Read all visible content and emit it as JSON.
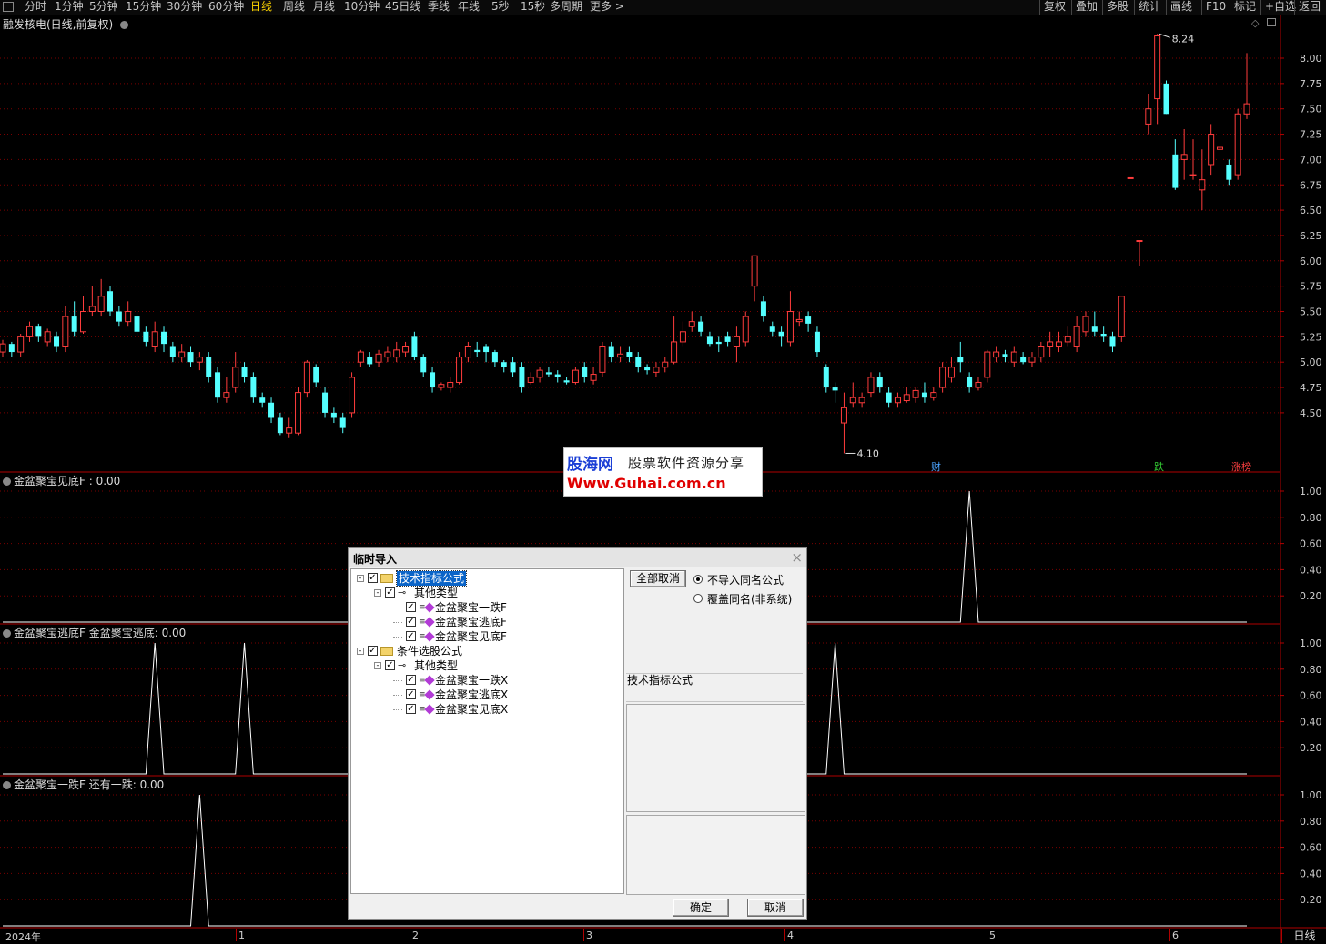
{
  "toolbar": {
    "periods": [
      "分时",
      "1分钟",
      "5分钟",
      "15分钟",
      "30分钟",
      "60分钟",
      "日线",
      "周线",
      "月线",
      "10分钟",
      "45日线",
      "季线",
      "年线",
      "5秒",
      "15秒",
      "多周期",
      "更多 >"
    ],
    "active_period": "日线",
    "right_buttons": [
      "复权",
      "叠加",
      "多股",
      "统计",
      "画线",
      "F10",
      "标记",
      "+自选",
      "返回"
    ]
  },
  "main_pane": {
    "title": "融发核电(日线,前复权)",
    "high_label": "8.24",
    "low_label": "4.10",
    "y_ticks": [
      "8.00",
      "7.75",
      "7.50",
      "7.25",
      "7.00",
      "6.75",
      "6.50",
      "6.25",
      "6.00",
      "5.75",
      "5.50",
      "5.25",
      "5.00",
      "4.75",
      "4.50"
    ],
    "markers": [
      {
        "text": "财",
        "color": "#4aa3ff"
      },
      {
        "text": "跌",
        "color": "#33cc33"
      },
      {
        "text": "涨榜",
        "color": "#ff4040"
      }
    ]
  },
  "indicator_panes": [
    {
      "title": "金盆聚宝见底F : 0.00",
      "y_ticks": [
        "1.00",
        "0.80",
        "0.60",
        "0.40",
        "0.20"
      ]
    },
    {
      "title": "金盆聚宝逃底F  金盆聚宝逃底: 0.00",
      "y_ticks": [
        "1.00",
        "0.80",
        "0.60",
        "0.40",
        "0.20"
      ]
    },
    {
      "title": "金盆聚宝一跌F  还有一跌: 0.00",
      "y_ticks": [
        "1.00",
        "0.80",
        "0.60",
        "0.40",
        "0.20"
      ]
    }
  ],
  "x_axis": {
    "labels": [
      "2024年",
      "1",
      "2",
      "3",
      "4",
      "5",
      "6"
    ],
    "period_label": "日线"
  },
  "watermark": {
    "logo": "股海网",
    "slogan": "股票软件资源分享",
    "url": "Www.Guhai.com.cn"
  },
  "dialog": {
    "title": "临时导入",
    "close": "×",
    "tree": [
      {
        "label": "技术指标公式",
        "level": 0,
        "kind": "folder",
        "selected": true
      },
      {
        "label": "其他类型",
        "level": 1,
        "kind": "key"
      },
      {
        "label": "金盆聚宝一跌F",
        "level": 2,
        "kind": "gem"
      },
      {
        "label": "金盆聚宝逃底F",
        "level": 2,
        "kind": "gem"
      },
      {
        "label": "金盆聚宝见底F",
        "level": 2,
        "kind": "gem"
      },
      {
        "label": "条件选股公式",
        "level": 0,
        "kind": "folder"
      },
      {
        "label": "其他类型",
        "level": 1,
        "kind": "key"
      },
      {
        "label": "金盆聚宝一跌X",
        "level": 2,
        "kind": "gem"
      },
      {
        "label": "金盆聚宝逃底X",
        "level": 2,
        "kind": "gem"
      },
      {
        "label": "金盆聚宝见底X",
        "level": 2,
        "kind": "gem"
      }
    ],
    "cancel_all_label": "全部取消",
    "radio_no_import": "不导入同名公式",
    "radio_overwrite": "覆盖同名(非系统)",
    "info_label": "技术指标公式",
    "ok_label": "确定",
    "cancel_label": "取消"
  },
  "colors": {
    "up": "#ff3c3c",
    "down": "#54ffff",
    "grid": "#7a0000",
    "axis": "#b00000",
    "active_tab": "#ffd700"
  },
  "chart_data": {
    "type": "candlestick",
    "title": "融发核电(日线,前复权)",
    "ylim": [
      4.0,
      8.3
    ],
    "note_extremes": {
      "high": 8.24,
      "low": 4.1
    },
    "x_labels": [
      "2024年",
      "1",
      "2",
      "3",
      "4",
      "5",
      "6"
    ],
    "candles": [
      [
        5.1,
        5.18,
        5.22,
        5.05
      ],
      [
        5.18,
        5.1,
        5.2,
        5.05
      ],
      [
        5.1,
        5.25,
        5.28,
        5.05
      ],
      [
        5.25,
        5.35,
        5.4,
        5.2
      ],
      [
        5.35,
        5.25,
        5.38,
        5.2
      ],
      [
        5.2,
        5.3,
        5.33,
        5.15
      ],
      [
        5.25,
        5.15,
        5.3,
        5.1
      ],
      [
        5.15,
        5.45,
        5.55,
        5.1
      ],
      [
        5.45,
        5.3,
        5.6,
        5.25
      ],
      [
        5.3,
        5.5,
        5.65,
        5.28
      ],
      [
        5.5,
        5.55,
        5.75,
        5.45
      ],
      [
        5.5,
        5.65,
        5.82,
        5.45
      ],
      [
        5.7,
        5.5,
        5.75,
        5.45
      ],
      [
        5.5,
        5.4,
        5.55,
        5.35
      ],
      [
        5.4,
        5.5,
        5.6,
        5.35
      ],
      [
        5.45,
        5.3,
        5.5,
        5.25
      ],
      [
        5.3,
        5.2,
        5.35,
        5.15
      ],
      [
        5.15,
        5.3,
        5.4,
        5.1
      ],
      [
        5.3,
        5.18,
        5.35,
        5.1
      ],
      [
        5.15,
        5.05,
        5.2,
        5.0
      ],
      [
        5.05,
        5.1,
        5.18,
        5.0
      ],
      [
        5.1,
        5.0,
        5.15,
        4.95
      ],
      [
        5.0,
        5.05,
        5.1,
        4.92
      ],
      [
        5.05,
        4.85,
        5.1,
        4.8
      ],
      [
        4.9,
        4.65,
        4.95,
        4.6
      ],
      [
        4.65,
        4.7,
        4.85,
        4.6
      ],
      [
        4.75,
        4.95,
        5.1,
        4.7
      ],
      [
        4.95,
        4.85,
        5.0,
        4.8
      ],
      [
        4.85,
        4.65,
        4.9,
        4.6
      ],
      [
        4.65,
        4.6,
        4.7,
        4.55
      ],
      [
        4.6,
        4.45,
        4.65,
        4.4
      ],
      [
        4.45,
        4.3,
        4.5,
        4.28
      ],
      [
        4.3,
        4.35,
        4.45,
        4.25
      ],
      [
        4.3,
        4.7,
        4.75,
        4.28
      ],
      [
        4.7,
        5.0,
        5.02,
        4.65
      ],
      [
        4.95,
        4.8,
        4.98,
        4.75
      ],
      [
        4.7,
        4.5,
        4.75,
        4.45
      ],
      [
        4.5,
        4.45,
        4.55,
        4.4
      ],
      [
        4.45,
        4.35,
        4.5,
        4.3
      ],
      [
        4.5,
        4.85,
        4.9,
        4.45
      ],
      [
        5.0,
        5.1,
        5.12,
        4.95
      ],
      [
        5.05,
        4.98,
        5.1,
        4.95
      ],
      [
        5.0,
        5.08,
        5.12,
        4.95
      ],
      [
        5.05,
        5.1,
        5.15,
        5.0
      ],
      [
        5.05,
        5.12,
        5.2,
        5.0
      ],
      [
        5.1,
        5.15,
        5.2,
        5.05
      ],
      [
        5.25,
        5.05,
        5.3,
        5.02
      ],
      [
        5.05,
        4.9,
        5.08,
        4.85
      ],
      [
        4.9,
        4.75,
        4.95,
        4.7
      ],
      [
        4.75,
        4.78,
        4.8,
        4.72
      ],
      [
        4.75,
        4.8,
        4.85,
        4.7
      ],
      [
        4.8,
        5.05,
        5.1,
        4.78
      ],
      [
        5.05,
        5.15,
        5.2,
        5.0
      ],
      [
        5.12,
        5.1,
        5.2,
        5.05
      ],
      [
        5.15,
        5.1,
        5.18,
        5.0
      ],
      [
        5.1,
        5.0,
        5.12,
        4.95
      ],
      [
        5.0,
        4.95,
        5.02,
        4.9
      ],
      [
        5.0,
        4.9,
        5.05,
        4.85
      ],
      [
        4.95,
        4.75,
        5.0,
        4.7
      ],
      [
        4.8,
        4.85,
        4.9,
        4.78
      ],
      [
        4.85,
        4.92,
        4.95,
        4.8
      ],
      [
        4.9,
        4.88,
        4.95,
        4.85
      ],
      [
        4.88,
        4.85,
        4.92,
        4.8
      ],
      [
        4.82,
        4.8,
        4.85,
        4.78
      ],
      [
        4.8,
        4.92,
        4.95,
        4.78
      ],
      [
        4.95,
        4.85,
        5.0,
        4.8
      ],
      [
        4.82,
        4.88,
        4.95,
        4.78
      ],
      [
        4.9,
        5.15,
        5.2,
        4.85
      ],
      [
        5.15,
        5.05,
        5.2,
        5.0
      ],
      [
        5.05,
        5.08,
        5.15,
        5.0
      ],
      [
        5.1,
        5.05,
        5.15,
        5.0
      ],
      [
        5.05,
        4.95,
        5.1,
        4.9
      ],
      [
        4.95,
        4.92,
        4.98,
        4.88
      ],
      [
        4.9,
        4.95,
        5.0,
        4.85
      ],
      [
        4.95,
        5.0,
        5.05,
        4.9
      ],
      [
        5.0,
        5.2,
        5.45,
        4.98
      ],
      [
        5.2,
        5.3,
        5.4,
        5.15
      ],
      [
        5.35,
        5.4,
        5.5,
        5.3
      ],
      [
        5.4,
        5.3,
        5.45,
        5.25
      ],
      [
        5.25,
        5.18,
        5.3,
        5.15
      ],
      [
        5.2,
        5.18,
        5.25,
        5.1
      ],
      [
        5.25,
        5.2,
        5.3,
        5.15
      ],
      [
        5.15,
        5.25,
        5.35,
        5.0
      ],
      [
        5.2,
        5.45,
        5.5,
        5.15
      ],
      [
        5.75,
        6.05,
        6.05,
        5.6
      ],
      [
        5.6,
        5.45,
        5.65,
        5.4
      ],
      [
        5.35,
        5.3,
        5.4,
        5.25
      ],
      [
        5.3,
        5.25,
        5.35,
        5.15
      ],
      [
        5.2,
        5.5,
        5.7,
        5.15
      ],
      [
        5.4,
        5.42,
        5.5,
        5.35
      ],
      [
        5.45,
        5.38,
        5.5,
        5.3
      ],
      [
        5.3,
        5.1,
        5.35,
        5.05
      ],
      [
        4.95,
        4.75,
        4.98,
        4.7
      ],
      [
        4.75,
        4.72,
        4.8,
        4.6
      ],
      [
        4.4,
        4.55,
        4.7,
        4.1
      ],
      [
        4.6,
        4.65,
        4.8,
        4.55
      ],
      [
        4.6,
        4.65,
        4.7,
        4.55
      ],
      [
        4.7,
        4.85,
        4.9,
        4.65
      ],
      [
        4.85,
        4.75,
        4.9,
        4.7
      ],
      [
        4.7,
        4.6,
        4.75,
        4.55
      ],
      [
        4.6,
        4.65,
        4.7,
        4.55
      ],
      [
        4.62,
        4.68,
        4.75,
        4.6
      ],
      [
        4.65,
        4.72,
        4.75,
        4.6
      ],
      [
        4.7,
        4.65,
        4.8,
        4.6
      ],
      [
        4.65,
        4.7,
        4.75,
        4.62
      ],
      [
        4.75,
        4.95,
        5.0,
        4.7
      ],
      [
        4.85,
        4.95,
        5.05,
        4.8
      ],
      [
        5.05,
        5.0,
        5.2,
        4.9
      ],
      [
        4.85,
        4.75,
        4.9,
        4.7
      ],
      [
        4.75,
        4.8,
        4.85,
        4.72
      ],
      [
        4.85,
        5.1,
        5.12,
        4.8
      ],
      [
        5.05,
        5.1,
        5.15,
        5.0
      ],
      [
        5.08,
        5.05,
        5.12,
        5.0
      ],
      [
        5.0,
        5.1,
        5.15,
        4.95
      ],
      [
        5.05,
        5.0,
        5.1,
        4.98
      ],
      [
        5.0,
        5.05,
        5.1,
        4.95
      ],
      [
        5.05,
        5.15,
        5.2,
        5.0
      ],
      [
        5.15,
        5.2,
        5.3,
        5.05
      ],
      [
        5.15,
        5.2,
        5.3,
        5.1
      ],
      [
        5.2,
        5.25,
        5.35,
        5.15
      ],
      [
        5.15,
        5.35,
        5.45,
        5.1
      ],
      [
        5.3,
        5.45,
        5.5,
        5.25
      ],
      [
        5.35,
        5.3,
        5.5,
        5.25
      ],
      [
        5.28,
        5.25,
        5.35,
        5.2
      ],
      [
        5.25,
        5.15,
        5.3,
        5.1
      ],
      [
        5.25,
        5.65,
        5.65,
        5.2
      ],
      [
        6.82,
        6.82,
        6.82,
        6.82
      ],
      [
        6.2,
        6.2,
        6.2,
        5.95
      ],
      [
        7.35,
        7.5,
        7.65,
        7.25
      ],
      [
        7.6,
        8.22,
        8.24,
        7.35
      ],
      [
        7.75,
        7.45,
        7.78,
        7.45
      ],
      [
        7.05,
        6.72,
        7.2,
        6.7
      ],
      [
        7.0,
        7.05,
        7.3,
        6.8
      ],
      [
        6.85,
        6.85,
        7.2,
        6.8
      ],
      [
        6.7,
        6.8,
        7.1,
        6.5
      ],
      [
        6.95,
        7.25,
        7.35,
        6.85
      ],
      [
        7.1,
        7.12,
        7.5,
        7.05
      ],
      [
        6.95,
        6.8,
        7.0,
        6.75
      ],
      [
        6.85,
        7.45,
        7.5,
        6.8
      ],
      [
        7.45,
        7.55,
        8.05,
        7.4
      ]
    ],
    "indicators": [
      {
        "name": "金盆聚宝见底F",
        "value": 0.0,
        "spikes_at_candle": [
          108
        ]
      },
      {
        "name": "金盆聚宝逃底F",
        "value": 0.0,
        "spikes_at_candle": [
          17,
          27,
          93
        ]
      },
      {
        "name": "金盆聚宝一跌F",
        "value": 0.0,
        "spikes_at_candle": [
          22
        ]
      }
    ]
  }
}
